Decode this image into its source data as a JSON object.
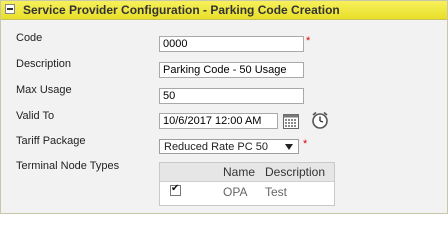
{
  "panel": {
    "title": "Service Provider Configuration - Parking Code Creation"
  },
  "form": {
    "code": {
      "label": "Code",
      "value": "0000",
      "required_mark": "*"
    },
    "description": {
      "label": "Description",
      "value": "Parking Code - 50 Usage"
    },
    "max_usage": {
      "label": "Max Usage",
      "value": "50"
    },
    "valid_to": {
      "label": "Valid To",
      "value": "10/6/2017 12:00 AM"
    },
    "tariff_package": {
      "label": "Tariff Package",
      "selected": "Reduced Rate PC 50",
      "required_mark": "*"
    },
    "terminal_node_types": {
      "label": "Terminal Node Types",
      "columns": [
        "Name",
        "Description"
      ],
      "rows": [
        {
          "checked": true,
          "name": "OPA",
          "description": "Test"
        }
      ]
    }
  },
  "colors": {
    "title_bar": "#f0e63c",
    "required": "#e00000"
  },
  "icons": [
    "calendar-icon",
    "clock-icon",
    "collapse-icon",
    "dropdown-arrow-icon",
    "checkmark-icon"
  ]
}
